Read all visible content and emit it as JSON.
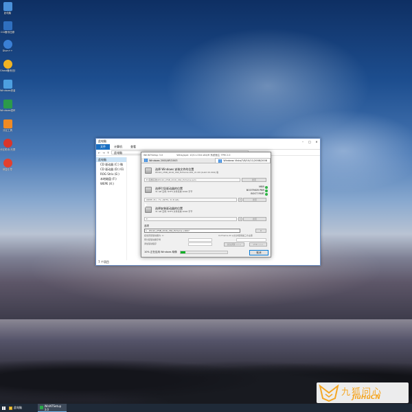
{
  "desktop": {
    "icons": [
      {
        "label": "此电脑",
        "color": "#4a90d9",
        "icon": "computer-icon"
      },
      {
        "label": "CGI备份还原",
        "color": "#2f6fbf",
        "icon": "backup-icon"
      },
      {
        "label": "Dism++",
        "color": "#3a7fd5",
        "icon": "gear-icon"
      },
      {
        "label": "Ghost备份还原",
        "color": "#f0b323",
        "icon": "ghost-icon"
      },
      {
        "label": "Windows安装器",
        "color": "#4d9fe0",
        "icon": "setup-icon"
      },
      {
        "label": "Windows密码修改",
        "color": "#2b9a4a",
        "icon": "lock-icon"
      },
      {
        "label": "分区工具",
        "color": "#f08a24",
        "icon": "partition-icon"
      },
      {
        "label": "分区助手(无损)",
        "color": "#d9352a",
        "icon": "partition-assistant-icon"
      },
      {
        "label": "修复引导",
        "color": "#e2402f",
        "icon": "repair-icon"
      }
    ]
  },
  "explorer": {
    "title": "此电脑",
    "tabs": [
      "文件",
      "计算机",
      "查看"
    ],
    "address": "此电脑",
    "right_hint": "",
    "sidebar": [
      "设备和驱",
      "CD 驱动器 (C:) 微",
      "CD 驱动器 (D:) 61",
      "ROG Strix (E:)",
      "本地磁盘 (F:)",
      "WEPE (X:)"
    ],
    "sidebar_header": "此电脑",
    "status": "7 个项目"
  },
  "dialog": {
    "title": "WinNTSetup 3.0",
    "title_mid": "Winsyspe: 10/11.004  x64/R 系统宿主  TPM 2.0",
    "tab_left": "Windows 2000/XP/2003",
    "tab_right": "Windows Vista/7/8/10/11/2008/2008",
    "sec1_head": "选择 Windows 安装文件的位置",
    "sec1_sub": "Win10_LTSB_2016_X64_Extreme.x64_ch-CN (build XX.X64) 版",
    "sec1_path": "E:\\镜像系统\\Win10_LTSB_2016_X64_Extreme.wim",
    "sec1_btn": "搜索",
    "sec2_head": "选择引导驱动器的位置",
    "sec2_sub": "31 GB 空闲; NTFS 文件系统 4096 字节",
    "sec2_path": "WEPE (H:) - FL: (NTFS, 31 B GB)",
    "sec2_btn": "搜索",
    "flags": [
      "MBR",
      "BOOTMGR PBR",
      "BOOT PART"
    ],
    "sec3_head": "选择安装驱动器的位置",
    "sec3_sub": "31 GB 空闲; NTFS 文件系统 4096 字节",
    "sec3_path": "F:",
    "sec3_btn": "搜索",
    "options_label": "选项",
    "edition": "1 - Win10_LTSB_2016_X64_Extreme v1607",
    "opt_row1": "挂载安装驱动器为: C:",
    "opt_row2": "UxTheme.dll 以允许使用第三方主题",
    "opt_row3": "预分配驱动器字母",
    "opt_row4": "添加驱动程序",
    "opt_row5": "优化调整 >>>",
    "opt_row6": "VHD >>>",
    "status": "10% 正在应用 Windows 映像",
    "progress": 10,
    "cancel": "取消"
  },
  "watermark": {
    "cn": "九狐问心",
    "en": "JiuHuCN"
  },
  "taskbar": {
    "explorer": "此电脑",
    "app": "WinNTSetup 3.0"
  }
}
